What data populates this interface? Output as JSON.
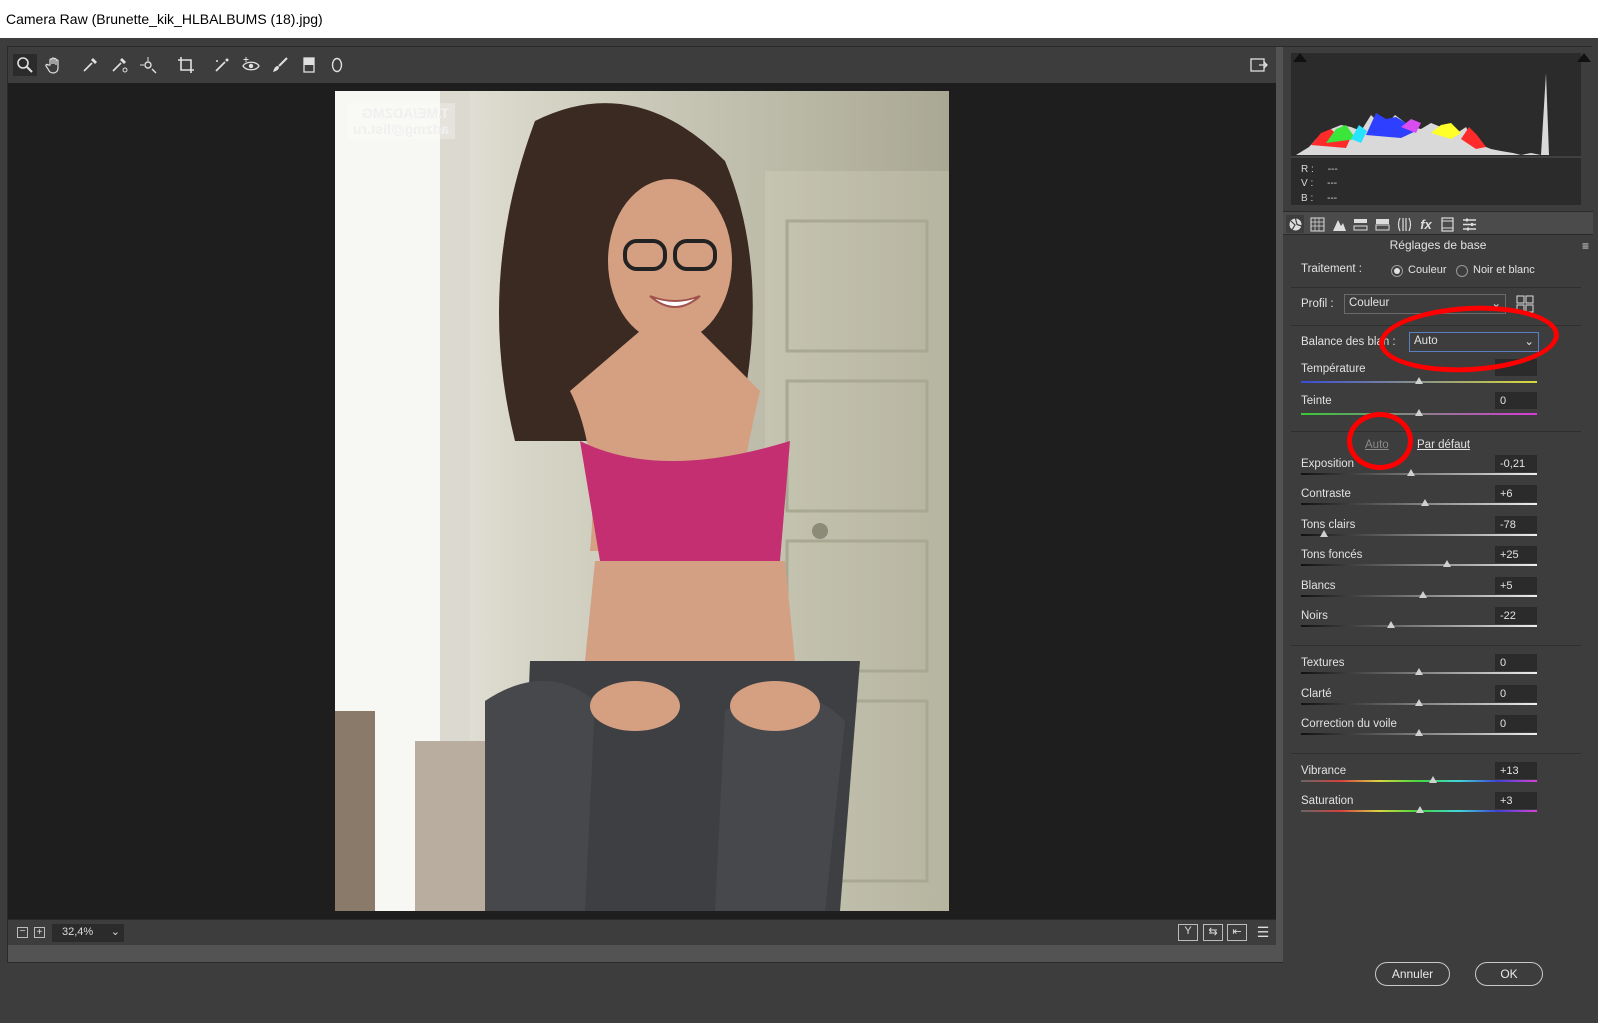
{
  "window": {
    "title": "Camera Raw (Brunette_kik_HLBALBUMS (18).jpg)"
  },
  "toolbar": {
    "tools": [
      "zoom-icon",
      "hand-icon",
      "white-balance-icon",
      "color-sampler-icon",
      "targeted-adjust-icon",
      "crop-icon",
      "straighten-icon",
      "red-eye-icon",
      "brush-icon",
      "gradient-icon",
      "radial-icon"
    ]
  },
  "photo": {
    "watermark_line1": "T.ME/ADZMG",
    "watermark_line2": "adzmg@list.ru"
  },
  "bottom": {
    "zoom": "32,4%"
  },
  "histogram": {
    "r_label": "R :",
    "r_val": "---",
    "g_label": "V :",
    "g_val": "---",
    "b_label": "B :",
    "b_val": "---"
  },
  "panel": {
    "section_title": "Réglages de base",
    "treatment_label": "Traitement :",
    "treatment_color": "Couleur",
    "treatment_bw": "Noir et blanc",
    "profile_label": "Profil :",
    "profile_value": "Couleur",
    "wb_label": "Balance des blan   :",
    "wb_value": "Auto",
    "temperature_label": "Température",
    "temperature_value": "",
    "tint_label": "Teinte",
    "tint_value": "0",
    "auto_link": "Auto",
    "default_link": "Par défaut",
    "sliders": [
      {
        "label": "Exposition",
        "value": "-0,21"
      },
      {
        "label": "Contraste",
        "value": "+6"
      },
      {
        "label": "Tons clairs",
        "value": "-78"
      },
      {
        "label": "Tons foncés",
        "value": "+25"
      },
      {
        "label": "Blancs",
        "value": "+5"
      },
      {
        "label": "Noirs",
        "value": "-22"
      },
      {
        "label": "Textures",
        "value": "0"
      },
      {
        "label": "Clarté",
        "value": "0"
      },
      {
        "label": "Correction du voile",
        "value": "0"
      },
      {
        "label": "Vibrance",
        "value": "+13"
      },
      {
        "label": "Saturation",
        "value": "+3"
      }
    ]
  },
  "footer": {
    "cancel": "Annuler",
    "ok": "OK"
  }
}
